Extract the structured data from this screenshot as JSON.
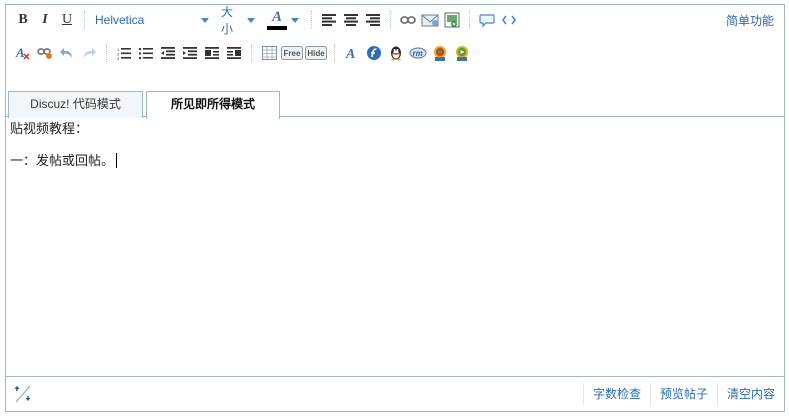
{
  "toolbar": {
    "bold_label": "B",
    "italic_label": "I",
    "underline_label": "U",
    "font_family": "Helvetica",
    "font_size": "大小",
    "font_color_label": "A",
    "font_color": "#000000",
    "simple_mode_label": "简单功能",
    "free_label": "Free",
    "hide_label": "Hide"
  },
  "tabs": [
    {
      "label": "Discuz! 代码模式",
      "active": false
    },
    {
      "label": "所见即所得模式",
      "active": true
    }
  ],
  "content": {
    "line1": "贴视频教程：",
    "line2": "一：发帖或回帖。"
  },
  "statusbar": {
    "word_count_label": "字数检查",
    "preview_label": "预览帖子",
    "clear_label": "清空内容"
  },
  "colors": {
    "border": "#9eb7c8",
    "link": "#2a6bb0",
    "icon_blue": "#3b6fb6"
  }
}
